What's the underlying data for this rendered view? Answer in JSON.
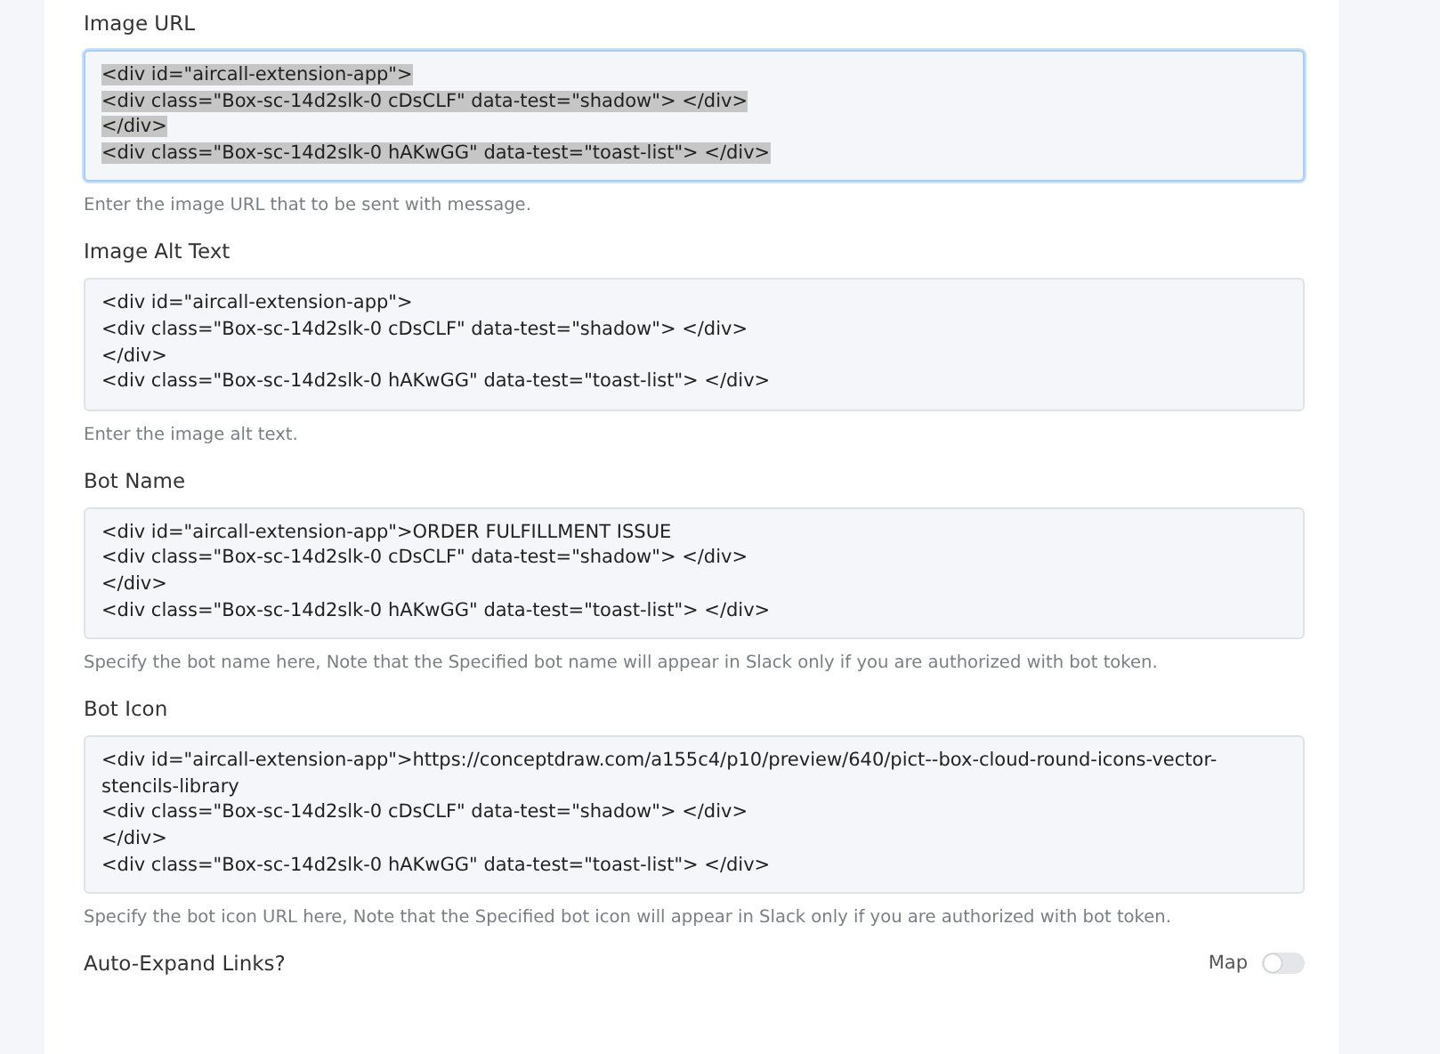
{
  "fields": [
    {
      "label": "Image URL",
      "focused": true,
      "highlighted": true,
      "lines": [
        "<div id=\"aircall-extension-app\">",
        "<div class=\"Box-sc-14d2slk-0 cDsCLF\" data-test=\"shadow\"> </div>",
        "</div>",
        "<div class=\"Box-sc-14d2slk-0 hAKwGG\" data-test=\"toast-list\"> </div>"
      ],
      "help": "Enter the image URL that to be sent with message."
    },
    {
      "label": "Image Alt Text",
      "focused": false,
      "highlighted": false,
      "lines": [
        "<div id=\"aircall-extension-app\">",
        "<div class=\"Box-sc-14d2slk-0 cDsCLF\" data-test=\"shadow\"> </div>",
        "</div>",
        "<div class=\"Box-sc-14d2slk-0 hAKwGG\" data-test=\"toast-list\"> </div>"
      ],
      "help": "Enter the image alt text."
    },
    {
      "label": "Bot Name",
      "focused": false,
      "highlighted": false,
      "lines": [
        "<div id=\"aircall-extension-app\">ORDER FULFILLMENT ISSUE",
        "<div class=\"Box-sc-14d2slk-0 cDsCLF\" data-test=\"shadow\"> </div>",
        "</div>",
        "<div class=\"Box-sc-14d2slk-0 hAKwGG\" data-test=\"toast-list\"> </div>"
      ],
      "help": "Specify the bot name here, Note that the Specified bot name will appear in Slack only if you are authorized with bot token."
    },
    {
      "label": "Bot Icon",
      "focused": false,
      "highlighted": false,
      "lines": [
        "<div id=\"aircall-extension-app\">https://conceptdraw.com/a155c4/p10/preview/640/pict--box-cloud-round-icons-vector-stencils-library",
        "<div class=\"Box-sc-14d2slk-0 cDsCLF\" data-test=\"shadow\"> </div>",
        "</div>",
        "<div class=\"Box-sc-14d2slk-0 hAKwGG\" data-test=\"toast-list\"> </div>"
      ],
      "help": "Specify the bot icon URL here, Note that the Specified bot icon will appear in Slack only if you are authorized with bot token."
    }
  ],
  "toggle": {
    "label": "Auto-Expand Links?",
    "state_label": "Map",
    "on": false
  }
}
